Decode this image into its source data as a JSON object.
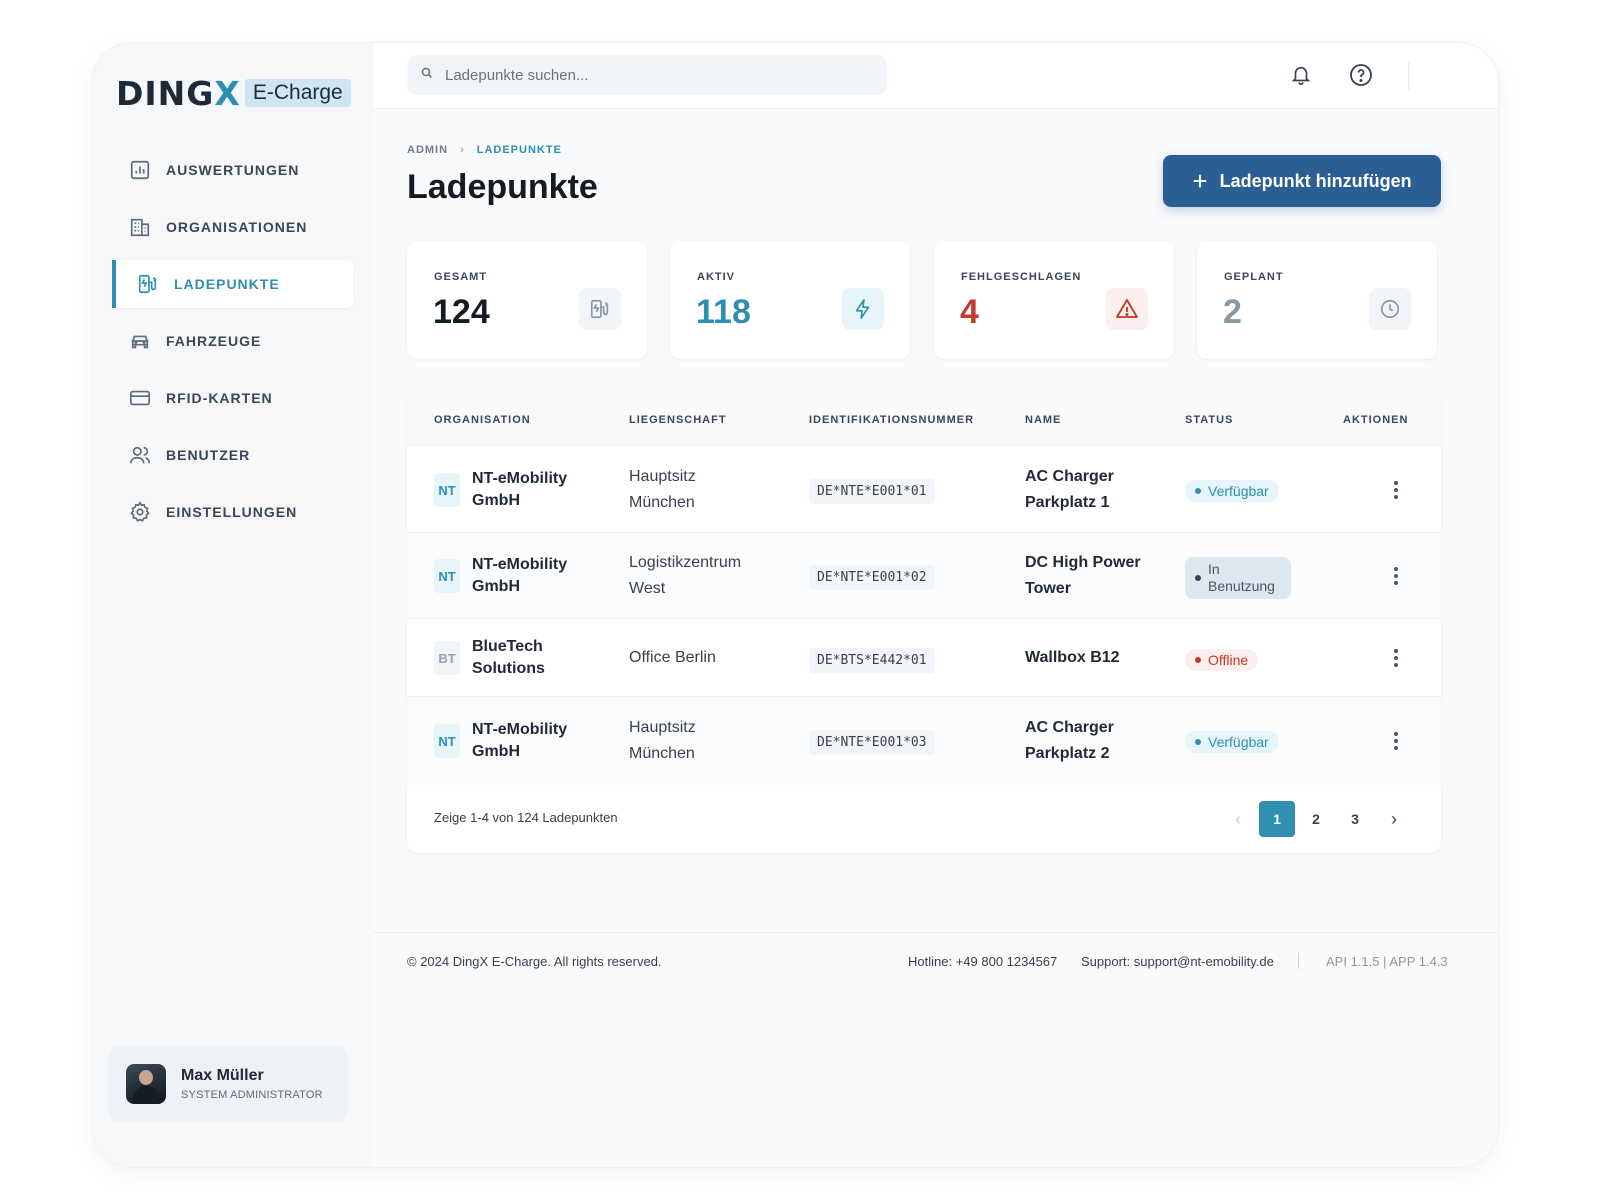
{
  "brand": {
    "name_main": "DING",
    "name_x": "X",
    "name_suffix": "E-Charge"
  },
  "nav": [
    {
      "label": "AUSWERTUNGEN",
      "icon": "chart-icon"
    },
    {
      "label": "ORGANISATIONEN",
      "icon": "building-icon"
    },
    {
      "label": "LADEPUNKTE",
      "icon": "charging-station-icon",
      "active": true
    },
    {
      "label": "FAHRZEUGE",
      "icon": "car-icon"
    },
    {
      "label": "RFID-KARTEN",
      "icon": "card-icon"
    },
    {
      "label": "BENUTZER",
      "icon": "users-icon"
    },
    {
      "label": "EINSTELLUNGEN",
      "icon": "gear-icon"
    }
  ],
  "user": {
    "name": "Max Müller",
    "role": "SYSTEM ADMINISTRATOR"
  },
  "search": {
    "placeholder": "Ladepunkte suchen..."
  },
  "breadcrumb": {
    "root": "ADMIN",
    "current": "LADEPUNKTE"
  },
  "page": {
    "title": "Ladepunkte",
    "add_button": "Ladepunkt hinzufügen"
  },
  "stats": [
    {
      "label": "GESAMT",
      "value": "124",
      "color": "#151b23",
      "icon": "charging-station-icon"
    },
    {
      "label": "AKTIV",
      "value": "118",
      "color": "#2f8fb0",
      "icon": "bolt-icon"
    },
    {
      "label": "FEHLGESCHLAGEN",
      "value": "4",
      "color": "#c0392b",
      "icon": "warning-icon"
    },
    {
      "label": "GEPLANT",
      "value": "2",
      "color": "#8a97a5",
      "icon": "clock-icon"
    }
  ],
  "table": {
    "headers": [
      "ORGANISATION",
      "LIEGENSCHAFT",
      "IDENTIFIKATIONSNUMMER",
      "NAME",
      "STATUS",
      "AKTIONEN"
    ],
    "rows": [
      {
        "org_abbr": "NT",
        "org_line1": "NT-eMobility",
        "org_line2": "GmbH",
        "prop_line1": "Hauptsitz",
        "prop_line2": "München",
        "id": "DE*NTE*E001*01",
        "name_line1": "AC Charger",
        "name_line2": "Parkplatz 1",
        "status": "Verfügbar"
      },
      {
        "org_abbr": "NT",
        "org_line1": "NT-eMobility",
        "org_line2": "GmbH",
        "prop_line1": "Logistikzentrum",
        "prop_line2": "West",
        "id": "DE*NTE*E001*02",
        "name_line1": "DC High Power",
        "name_line2": "Tower",
        "status_line1": "In",
        "status_line2": "Benutzung"
      },
      {
        "org_abbr": "BT",
        "org_line1": "BlueTech",
        "org_line2": "Solutions",
        "prop_line1": "Office Berlin",
        "id": "DE*BTS*E442*01",
        "name_line1": "Wallbox B12",
        "status": "Offline"
      },
      {
        "org_abbr": "NT",
        "org_line1": "NT-eMobility",
        "org_line2": "GmbH",
        "prop_line1": "Hauptsitz",
        "prop_line2": "München",
        "id": "DE*NTE*E001*03",
        "name_line1": "AC Charger",
        "name_line2": "Parkplatz 2",
        "status": "Verfügbar"
      }
    ],
    "summary": "Zeige 1-4 von 124 Ladepunkten",
    "pages": [
      "1",
      "2",
      "3"
    ],
    "current_page": "1"
  },
  "footer": {
    "copyright": "© 2024 DingX E-Charge. All rights reserved.",
    "hotline": "Hotline: +49 800 1234567",
    "support": "Support: support@nt-emobility.de",
    "version": "API 1.1.5 | APP 1.4.3"
  },
  "colors": {
    "accent": "#2f8fb0",
    "primary_button": "#2b5f93",
    "danger": "#c0392b"
  }
}
